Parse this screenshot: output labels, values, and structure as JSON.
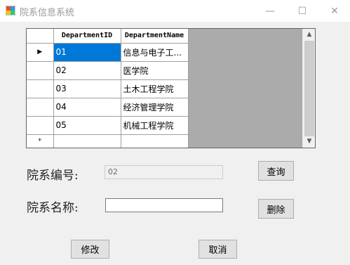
{
  "window": {
    "title": "院系信息系统",
    "minimize_glyph": "—",
    "maximize_glyph": "☐",
    "close_glyph": "✕"
  },
  "grid": {
    "columns": [
      "DepartmentID",
      "DepartmentName"
    ],
    "rows": [
      {
        "id": "01",
        "name": "信息与电子工..."
      },
      {
        "id": "02",
        "name": "医学院"
      },
      {
        "id": "03",
        "name": "土木工程学院"
      },
      {
        "id": "04",
        "name": "经济管理学院"
      },
      {
        "id": "05",
        "name": "机械工程学院"
      }
    ],
    "current_row_marker": "▶",
    "new_row_marker": "*",
    "scroll_up": "▲",
    "scroll_down": "▼"
  },
  "form": {
    "dept_id_label": "院系编号:",
    "dept_id_value": "02",
    "dept_name_label": "院系名称:",
    "dept_name_value": ""
  },
  "buttons": {
    "query": "查询",
    "delete": "删除",
    "modify": "修改",
    "cancel": "取消"
  }
}
